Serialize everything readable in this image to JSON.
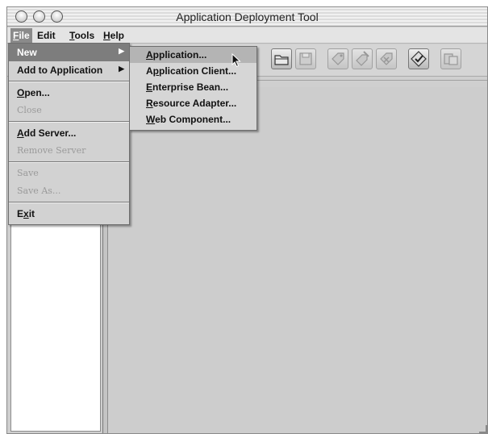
{
  "window": {
    "title": "Application Deployment Tool"
  },
  "menubar": [
    {
      "label": "File",
      "mnemonic": "F",
      "rest": "ile",
      "active": true
    },
    {
      "label": "Edit",
      "mnemonic": "",
      "rest": "Edit",
      "active": false
    },
    {
      "label": "Tools",
      "mnemonic": "T",
      "rest": "ools",
      "active": false
    },
    {
      "label": "Help",
      "mnemonic": "H",
      "rest": "elp",
      "active": false
    }
  ],
  "file_menu": {
    "items": [
      {
        "label": "New",
        "has_submenu": true,
        "enabled": true,
        "highlighted": true
      },
      {
        "label": "Add to Application",
        "has_submenu": true,
        "enabled": true
      },
      {
        "separator": true
      },
      {
        "label": "Open...",
        "mnemonic": "O",
        "enabled": true
      },
      {
        "label": "Close",
        "enabled": false
      },
      {
        "separator": true
      },
      {
        "label": "Add Server...",
        "mnemonic": "A",
        "enabled": true
      },
      {
        "label": "Remove Server",
        "enabled": false
      },
      {
        "separator": true
      },
      {
        "label": "Save",
        "enabled": false
      },
      {
        "label": "Save As...",
        "enabled": false
      },
      {
        "separator": true
      },
      {
        "label": "Exit",
        "mnemonic": "x",
        "enabled": true
      }
    ]
  },
  "new_submenu": {
    "items": [
      {
        "label": "Application...",
        "mnemonic": "A",
        "highlighted": true
      },
      {
        "label": "Application Client...",
        "mnemonic": "p"
      },
      {
        "label": "Enterprise Bean...",
        "mnemonic": "E"
      },
      {
        "label": "Resource Adapter...",
        "mnemonic": "R"
      },
      {
        "label": "Web Component...",
        "mnemonic": "W"
      }
    ]
  },
  "toolbar": {
    "buttons": [
      {
        "icon": "open-folder-icon",
        "enabled": true
      },
      {
        "icon": "save-disk-icon",
        "enabled": false
      },
      {
        "icon": "tag-icon",
        "enabled": false
      },
      {
        "icon": "edit-tag-icon",
        "enabled": false
      },
      {
        "icon": "remove-tag-icon",
        "enabled": false
      },
      {
        "icon": "verify-check-icon",
        "enabled": true
      },
      {
        "icon": "deploy-icon",
        "enabled": false
      }
    ]
  }
}
